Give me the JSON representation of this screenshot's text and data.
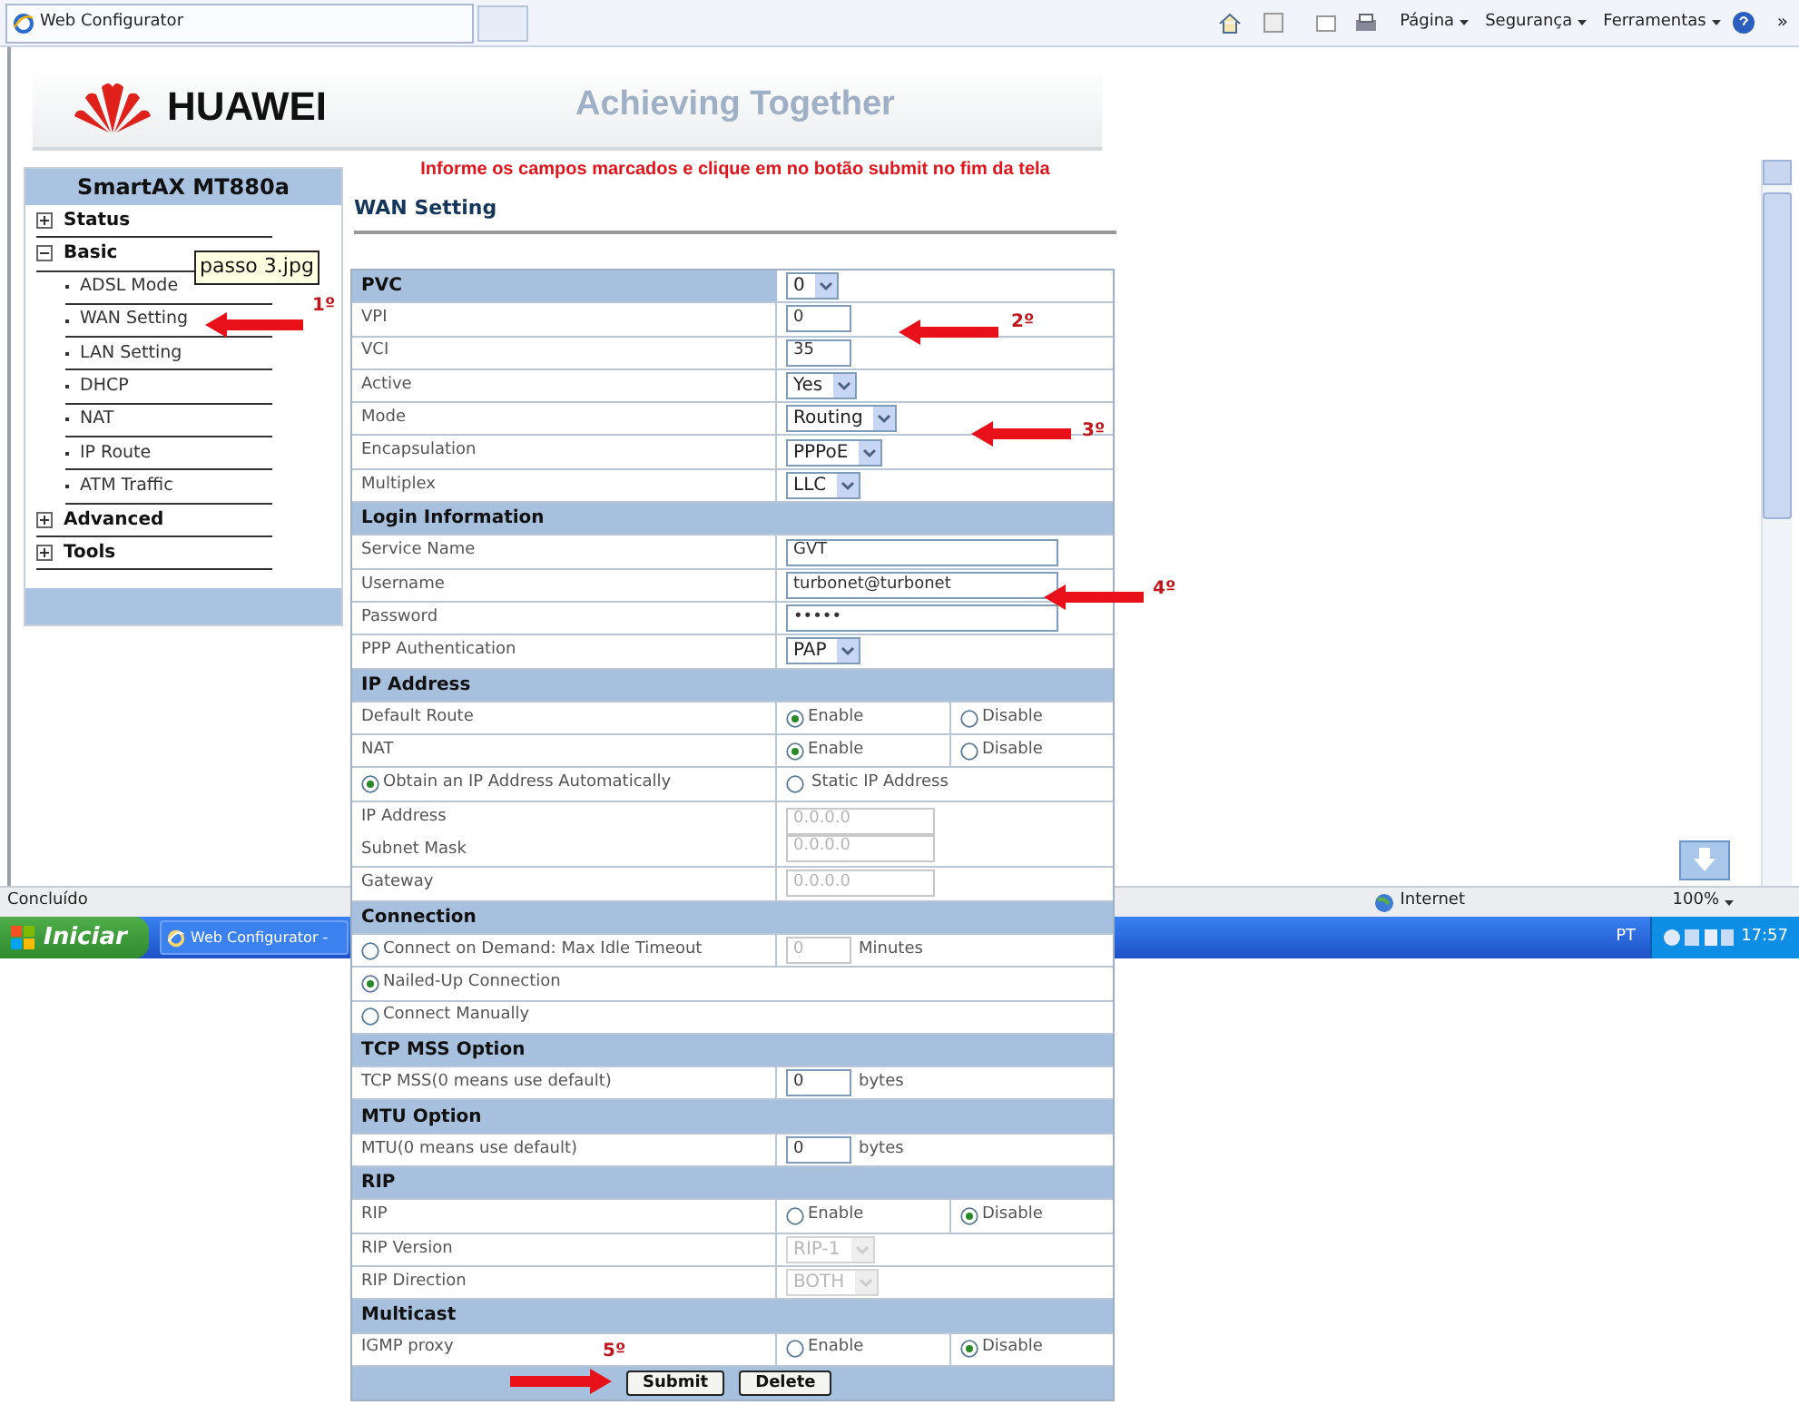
{
  "browser": {
    "tab_title": "Web Configurator",
    "menu": [
      {
        "label": "Página"
      },
      {
        "label": "Segurança"
      },
      {
        "label": "Ferramentas"
      }
    ],
    "overflow": "»"
  },
  "header": {
    "brand": "HUAWEI",
    "slogan": "Achieving Together"
  },
  "sidebar": {
    "title": "SmartAX MT880a",
    "items": [
      {
        "label": "Status",
        "expanded": false
      },
      {
        "label": "Basic",
        "expanded": true,
        "children": [
          {
            "label": "ADSL Mode"
          },
          {
            "label": "WAN Setting"
          },
          {
            "label": "LAN Setting"
          },
          {
            "label": "DHCP"
          },
          {
            "label": "NAT"
          },
          {
            "label": "IP Route"
          },
          {
            "label": "ATM Traffic"
          }
        ]
      },
      {
        "label": "Advanced",
        "expanded": false
      },
      {
        "label": "Tools",
        "expanded": false
      }
    ]
  },
  "tooltip": "passo 3.jpg",
  "notice": "Informe os campos marcados e clique em no botão submit no fim da tela",
  "page_title": "WAN Setting",
  "form": {
    "sections": [
      {
        "title": "PVC",
        "select": {
          "value": "0"
        },
        "rows": [
          {
            "kind": "text",
            "label": "VPI",
            "value": "0"
          },
          {
            "kind": "text",
            "label": "VCI",
            "value": "35"
          },
          {
            "kind": "select",
            "label": "Active",
            "value": "Yes"
          },
          {
            "kind": "select",
            "label": "Mode",
            "value": "Routing"
          },
          {
            "kind": "select",
            "label": "Encapsulation",
            "value": "PPPoE"
          },
          {
            "kind": "select",
            "label": "Multiplex",
            "value": "LLC"
          }
        ]
      },
      {
        "title": "Login Information",
        "rows": [
          {
            "kind": "text_long",
            "label": "Service Name",
            "value": "GVT"
          },
          {
            "kind": "text_long",
            "label": "Username",
            "value": "turbonet@turbonet"
          },
          {
            "kind": "text_long",
            "label": "Password",
            "value": "•••••"
          },
          {
            "kind": "select",
            "label": "PPP Authentication",
            "value": "PAP"
          }
        ]
      },
      {
        "title": "IP Address",
        "rows": [
          {
            "kind": "choice",
            "label": "Default Route",
            "options": [
              {
                "label": "Enable",
                "selected": true
              },
              {
                "label": "Disable",
                "selected": false
              }
            ]
          },
          {
            "kind": "choice",
            "label": "NAT",
            "options": [
              {
                "label": "Enable",
                "selected": true
              },
              {
                "label": "Disable",
                "selected": false
              }
            ]
          },
          {
            "kind": "radio_pair",
            "options": [
              {
                "label": "Obtain an IP Address Automatically",
                "selected": true
              },
              {
                "label": "Static IP Address",
                "selected": false
              }
            ]
          },
          {
            "kind": "multi_address",
            "disabled": true,
            "fields": [
              {
                "label": "IP Address",
                "value": "0.0.0.0"
              },
              {
                "label": "Subnet Mask",
                "value": "0.0.0.0"
              }
            ]
          },
          {
            "kind": "address",
            "label": "Gateway",
            "value": "0.0.0.0",
            "disabled": true
          }
        ]
      },
      {
        "title": "Connection",
        "rows": [
          {
            "kind": "radio_input",
            "label": "Connect on Demand: Max Idle Timeout",
            "selected": false,
            "value": "0",
            "unit": "Minutes",
            "disabled": true
          },
          {
            "kind": "radio",
            "label": "Nailed-Up Connection",
            "selected": true
          },
          {
            "kind": "radio",
            "label": "Connect Manually",
            "selected": false
          }
        ]
      },
      {
        "title": "TCP MSS Option",
        "rows": [
          {
            "kind": "text",
            "label": "TCP MSS(0 means use default)",
            "value": "0",
            "unit": "bytes"
          }
        ]
      },
      {
        "title": "MTU Option",
        "rows": [
          {
            "kind": "text",
            "label": "MTU(0 means use default)",
            "value": "0",
            "unit": "bytes"
          }
        ]
      },
      {
        "title": "RIP",
        "rows": [
          {
            "kind": "choice",
            "label": "RIP",
            "options": [
              {
                "label": "Enable",
                "selected": false
              },
              {
                "label": "Disable",
                "selected": true
              }
            ]
          },
          {
            "kind": "select",
            "label": "RIP Version",
            "value": "RIP-1",
            "disabled": true
          },
          {
            "kind": "select",
            "label": "RIP Direction",
            "value": "BOTH",
            "disabled": true
          }
        ]
      },
      {
        "title": "Multicast",
        "rows": [
          {
            "kind": "choice",
            "label": "IGMP proxy",
            "options": [
              {
                "label": "Enable",
                "selected": false
              },
              {
                "label": "Disable",
                "selected": true
              }
            ]
          }
        ]
      }
    ],
    "buttons": [
      {
        "label": "Submit"
      },
      {
        "label": "Delete"
      }
    ]
  },
  "annotations": [
    {
      "label": "1º",
      "points_right": false
    },
    {
      "label": "2º",
      "points_right": false
    },
    {
      "label": "3º",
      "points_right": false
    },
    {
      "label": "4º",
      "points_right": false
    },
    {
      "label": "5º",
      "points_right": true
    }
  ],
  "status_bar": {
    "text": "Concluído",
    "zone": "Internet",
    "zoom": "100%"
  },
  "taskbar": {
    "start": "Iniciar",
    "tasks": [
      {
        "label": "Web Configurator -"
      }
    ],
    "language": "PT",
    "clock": "17:57"
  }
}
